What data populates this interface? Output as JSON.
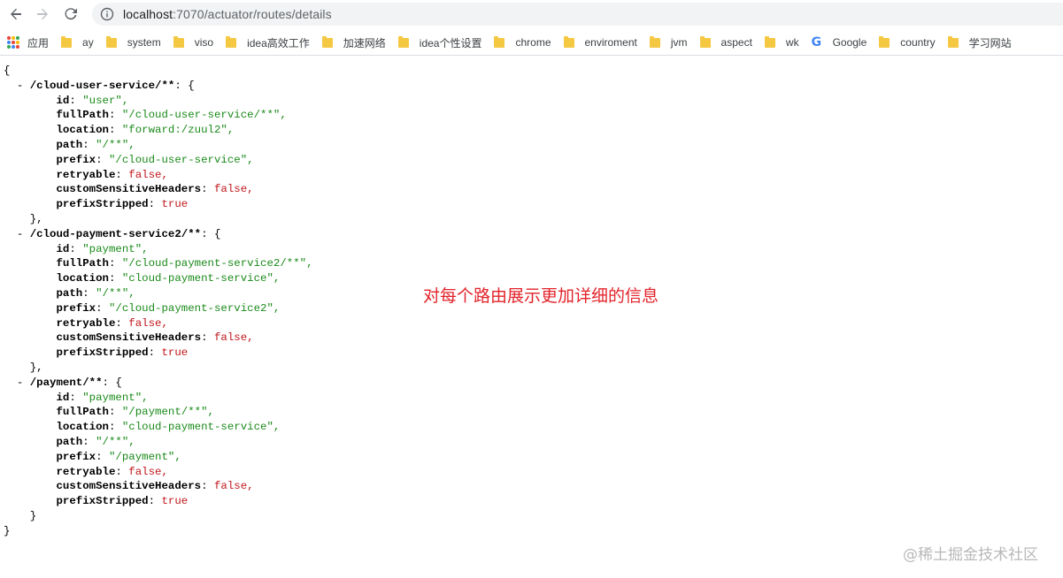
{
  "browser": {
    "url_host": "localhost",
    "url_path": ":7070/actuator/routes/details",
    "icons": {
      "back": "arrow-left-icon",
      "forward": "arrow-right-icon",
      "reload": "reload-icon",
      "info": "info-icon"
    }
  },
  "bookmarks": [
    {
      "label": "应用",
      "icon": "apps-icon"
    },
    {
      "label": "ay",
      "icon": "folder-icon"
    },
    {
      "label": "system",
      "icon": "folder-icon"
    },
    {
      "label": "viso",
      "icon": "folder-icon"
    },
    {
      "label": "idea高效工作",
      "icon": "folder-icon"
    },
    {
      "label": "加速网络",
      "icon": "folder-icon"
    },
    {
      "label": "idea个性设置",
      "icon": "folder-icon"
    },
    {
      "label": "chrome",
      "icon": "folder-icon"
    },
    {
      "label": "enviroment",
      "icon": "folder-icon"
    },
    {
      "label": "jvm",
      "icon": "folder-icon"
    },
    {
      "label": "aspect",
      "icon": "folder-icon"
    },
    {
      "label": "wk",
      "icon": "folder-icon"
    },
    {
      "label": "Google",
      "icon": "google-icon"
    },
    {
      "label": "country",
      "icon": "folder-icon"
    },
    {
      "label": "学习网站",
      "icon": "folder-icon"
    }
  ],
  "routes": [
    {
      "name": "/cloud-user-service/**",
      "fields": [
        {
          "k": "id",
          "v": "\"user\","
        },
        {
          "k": "fullPath",
          "v": "\"/cloud-user-service/**\","
        },
        {
          "k": "location",
          "v": "\"forward:/zuul2\","
        },
        {
          "k": "path",
          "v": "\"/**\","
        },
        {
          "k": "prefix",
          "v": "\"/cloud-user-service\","
        },
        {
          "k": "retryable",
          "v": "false,"
        },
        {
          "k": "customSensitiveHeaders",
          "v": "false,"
        },
        {
          "k": "prefixStripped",
          "v": "true"
        }
      ],
      "close": "},"
    },
    {
      "name": "/cloud-payment-service2/**",
      "fields": [
        {
          "k": "id",
          "v": "\"payment\","
        },
        {
          "k": "fullPath",
          "v": "\"/cloud-payment-service2/**\","
        },
        {
          "k": "location",
          "v": "\"cloud-payment-service\","
        },
        {
          "k": "path",
          "v": "\"/**\","
        },
        {
          "k": "prefix",
          "v": "\"/cloud-payment-service2\","
        },
        {
          "k": "retryable",
          "v": "false,"
        },
        {
          "k": "customSensitiveHeaders",
          "v": "false,"
        },
        {
          "k": "prefixStripped",
          "v": "true"
        }
      ],
      "close": "},"
    },
    {
      "name": "/payment/**",
      "fields": [
        {
          "k": "id",
          "v": "\"payment\","
        },
        {
          "k": "fullPath",
          "v": "\"/payment/**\","
        },
        {
          "k": "location",
          "v": "\"cloud-payment-service\","
        },
        {
          "k": "path",
          "v": "\"/**\","
        },
        {
          "k": "prefix",
          "v": "\"/payment\","
        },
        {
          "k": "retryable",
          "v": "false,"
        },
        {
          "k": "customSensitiveHeaders",
          "v": "false,"
        },
        {
          "k": "prefixStripped",
          "v": "true"
        }
      ],
      "close": "}"
    }
  ],
  "json_open": "{",
  "json_close": "}",
  "annotation": "对每个路由展示更加详细的信息",
  "watermark": "@稀土掘金技术社区",
  "colors": {
    "string": "#1a8a1a",
    "boolean": "#c0161b",
    "annotation": "#e2232a",
    "folder": "#f5c842"
  }
}
